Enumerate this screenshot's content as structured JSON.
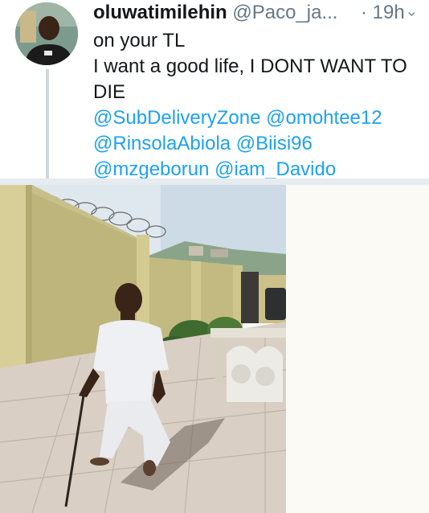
{
  "tweet": {
    "display_name": "oluwatimilehin",
    "handle": "@Paco_ja...",
    "time": "· 19h",
    "lines": [
      "on your TL",
      "I want a good life, I DONT WANT TO",
      "DIE"
    ],
    "mentions": [
      [
        "@SubDeliveryZone",
        "@omohtee12"
      ],
      [
        "@RinsolaAbiola",
        "@Biisi96"
      ],
      [
        "@mzgeborun",
        "@iam_Davido"
      ]
    ]
  },
  "colors": {
    "link": "#1da1f2",
    "text": "#14171a",
    "muted": "#657786",
    "divider": "#e6ecf0"
  },
  "icons": {
    "menu": "chevron-down-icon"
  }
}
